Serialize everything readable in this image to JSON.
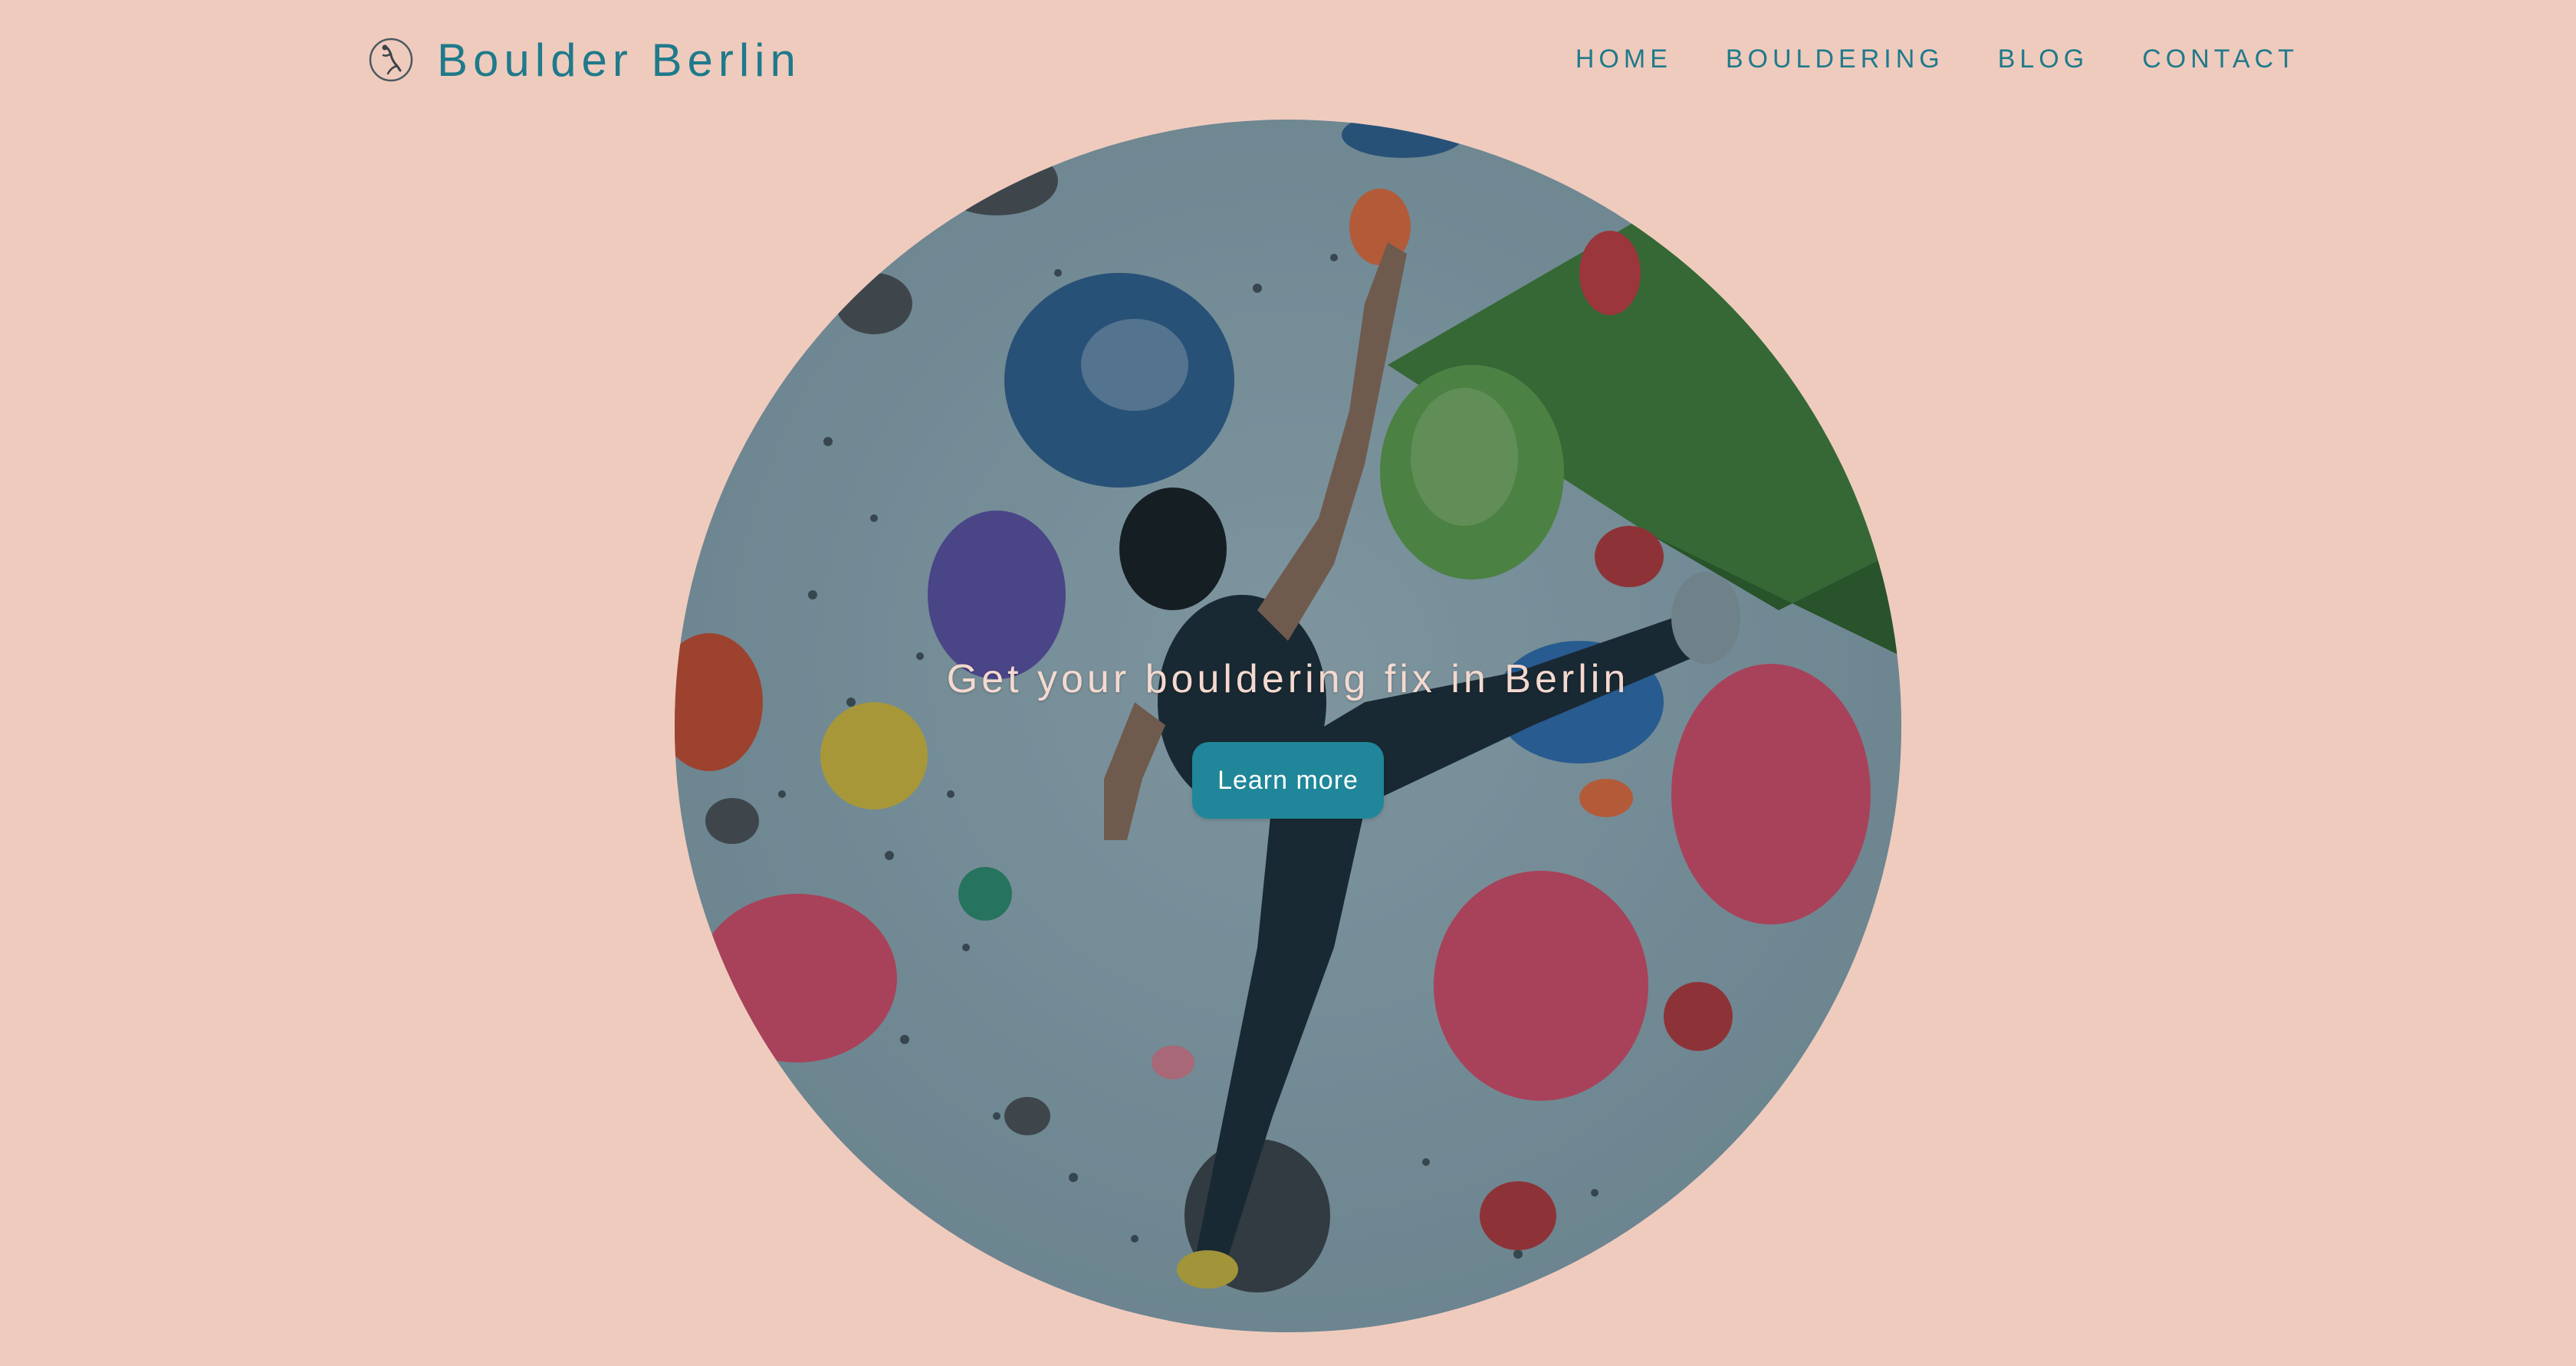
{
  "brand": {
    "name": "Boulder Berlin",
    "logo_icon": "climber-logo-icon"
  },
  "nav": {
    "items": [
      {
        "label": "HOME"
      },
      {
        "label": "BOULDERING"
      },
      {
        "label": "BLOG"
      },
      {
        "label": "CONTACT"
      }
    ]
  },
  "hero": {
    "title": "Get your bouldering fix in Berlin",
    "button_label": "Learn more",
    "image_subject": "climber-on-bouldering-wall-photo"
  },
  "colors": {
    "background": "#efcbbe",
    "accent": "#1f7a8a",
    "button": "#1f8799",
    "wall": "#8fa9b3"
  }
}
